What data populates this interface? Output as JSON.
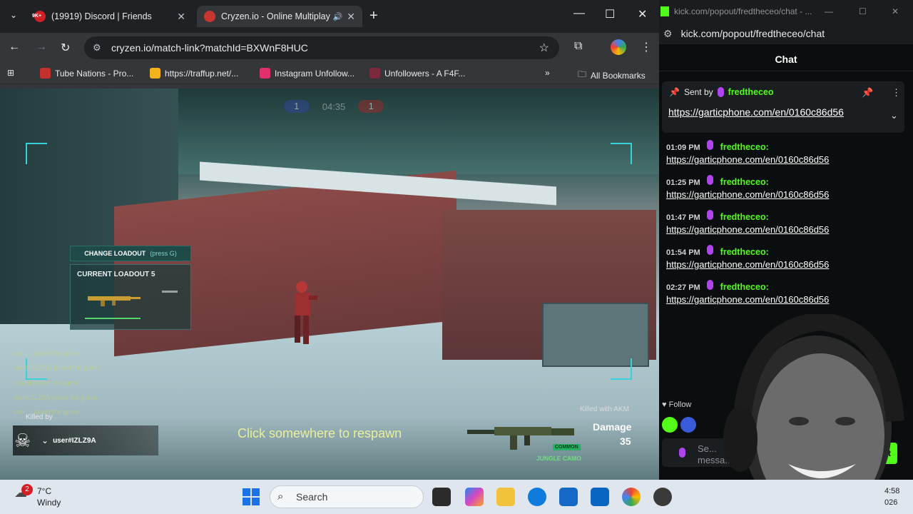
{
  "browser": {
    "tabs": [
      {
        "title": "(19919) Discord | Friends",
        "active": false
      },
      {
        "title": "Cryzen.io - Online Multiplay",
        "active": true
      }
    ],
    "discord_badge": "9K+",
    "url": "cryzen.io/match-link?matchId=BXWnF8HUC",
    "bookmarks": [
      "Tube Nations - Pro...",
      "https://traffup.net/...",
      "Instagram Unfollow...",
      "Unfollowers - A F4F...",
      "All Bookmarks"
    ],
    "icons": [
      "chevron-down-icon",
      "close-icon",
      "speaker-icon",
      "plus-icon",
      "minimize-icon",
      "maximize-icon",
      "back-icon",
      "forward-icon",
      "reload-icon",
      "site-info-icon",
      "star-icon",
      "extensions-icon",
      "menu-icon",
      "apps-icon",
      "folder-icon"
    ]
  },
  "game": {
    "score_left": "1",
    "timer": "04:35",
    "score_right": "1",
    "loadout": {
      "header": "CHANGE LOADOUT",
      "key_hint": "(press G)",
      "current": "CURRENT LOADOUT 5"
    },
    "feed": [
      "user… joined the game",
      "user8DZ1VJ7 joined the game",
      "zzcarli joined the game",
      "user#IZLZ9A joined the game",
      "user… joined the game"
    ],
    "killed_by_label": "Killed by",
    "killer_name": "user#IZLZ9A",
    "respawn_text": "Click somewhere to respawn",
    "killed_with": "Killed with AKM",
    "damage_label": "Damage",
    "damage_value": "35",
    "rarity": "COMMON",
    "camo": "JUNGLE CAMO",
    "colors": {
      "frame": "#39d0d8",
      "respawn": "#e8ef9c",
      "camo": "#6ee07a"
    }
  },
  "kick": {
    "window_title": "kick.com/popout/fredtheceo/chat - ...",
    "url": "kick.com/popout/fredtheceo/chat",
    "chat_title": "Chat",
    "pinned": {
      "sent_by": "Sent by",
      "user": "fredtheceo",
      "link": "https://garticphone.com/en/0160c86d56"
    },
    "messages": [
      {
        "time": "01:09 PM",
        "user": "fredtheceo:",
        "text": "https://garticphone.com/en/0160c86d56"
      },
      {
        "time": "01:25 PM",
        "user": "fredtheceo:",
        "text": "https://garticphone.com/en/0160c86d56"
      },
      {
        "time": "01:47 PM",
        "user": "fredtheceo:",
        "text": "https://garticphone.com/en/0160c86d56"
      },
      {
        "time": "01:54 PM",
        "user": "fredtheceo:",
        "text": "https://garticphone.com/en/0160c86d56"
      },
      {
        "time": "02:27 PM",
        "user": "fredtheceo:",
        "text": "https://garticphone.com/en/0160c86d56"
      }
    ],
    "follow_text": "Follow",
    "input_placeholder": "Se... messa...",
    "send_label": "t",
    "colors": {
      "brand": "#53fc18",
      "mic": "#b045f0"
    }
  },
  "taskbar": {
    "weather_badge": "2",
    "temp": "7°C",
    "condition": "Windy",
    "search_placeholder": "Search",
    "time": "4:58",
    "date": "026"
  }
}
